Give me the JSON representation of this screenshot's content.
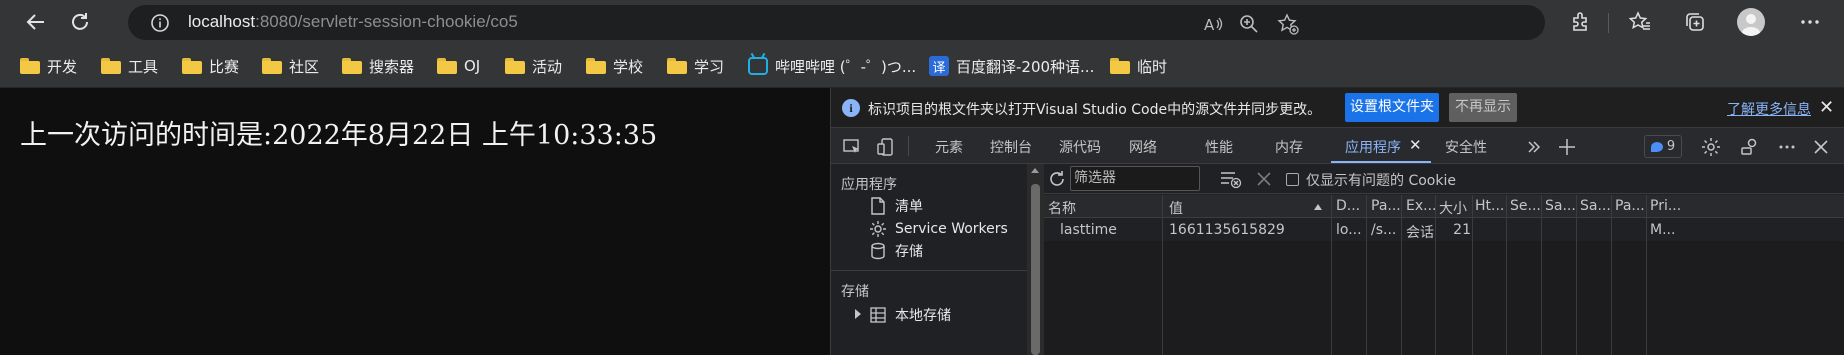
{
  "browser": {
    "url_host": "localhost",
    "url_rest": ":8080/servletr-session-chookie/co5",
    "icons": [
      "back-icon",
      "refresh-icon",
      "site-info-icon",
      "read-aloud-icon",
      "zoom-icon",
      "add-favorite-icon",
      "extensions-icon",
      "favorites-icon",
      "collections-icon",
      "profile-avatar",
      "more-icon"
    ]
  },
  "bookmarks": [
    {
      "label": "开发",
      "icon": "folder-icon"
    },
    {
      "label": "工具",
      "icon": "folder-icon"
    },
    {
      "label": "比赛",
      "icon": "folder-icon"
    },
    {
      "label": "社区",
      "icon": "folder-icon"
    },
    {
      "label": "搜索器",
      "icon": "folder-icon"
    },
    {
      "label": "OJ",
      "icon": "folder-icon"
    },
    {
      "label": "活动",
      "icon": "folder-icon"
    },
    {
      "label": "学校",
      "icon": "folder-icon"
    },
    {
      "label": "学习",
      "icon": "folder-icon"
    },
    {
      "label": "哔哩哔哩 (゜-゜)つ...",
      "icon": "bilibili-icon"
    },
    {
      "label": "百度翻译-200种语...",
      "icon": "baidu-fanyi-icon"
    },
    {
      "label": "临时",
      "icon": "folder-icon"
    }
  ],
  "page": {
    "text": "上一次访问的时间是:2022年8月22日 上午10:33:35"
  },
  "devtools": {
    "infobar": {
      "message": "标识项目的根文件夹以打开Visual Studio Code中的源文件并同步更改。",
      "primary_button": "设置根文件夹",
      "secondary_button": "不再显示",
      "learn_more": "了解更多信息",
      "close": "✕"
    },
    "tabs": [
      "元素",
      "控制台",
      "源代码",
      "网络",
      "性能",
      "内存",
      "应用程序",
      "安全性"
    ],
    "active_tab": "应用程序",
    "issue_count": "9",
    "sidebar": {
      "section_app": "应用程序",
      "items": [
        "清单",
        "Service Workers",
        "存储"
      ],
      "section_storage": "存储",
      "storage_items": [
        "本地存储"
      ]
    },
    "cookies": {
      "filter_placeholder": "筛选器",
      "only_issues_label": "仅显示有问题的 Cookie",
      "columns": [
        "名称",
        "值",
        "D...",
        "Pa...",
        "Ex...",
        "大小",
        "Ht...",
        "Se...",
        "Sa...",
        "Sa...",
        "Pa...",
        "Pri..."
      ],
      "rows": [
        [
          "lasttime",
          "1661135615829",
          "lo...",
          "/s...",
          "会话",
          "21",
          "",
          "",
          "",
          "",
          "",
          "M..."
        ]
      ]
    }
  }
}
